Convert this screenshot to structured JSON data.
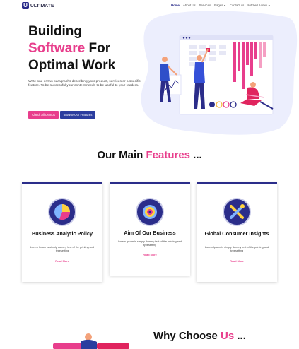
{
  "brand": {
    "logo_letter": "U",
    "name": "ULTIMATE"
  },
  "nav": {
    "items": [
      {
        "label": "Home",
        "active": true,
        "dropdown": false
      },
      {
        "label": "About Us",
        "active": false,
        "dropdown": false
      },
      {
        "label": "Services",
        "active": false,
        "dropdown": false
      },
      {
        "label": "Pages",
        "active": false,
        "dropdown": true
      },
      {
        "label": "Contact us",
        "active": false,
        "dropdown": false
      },
      {
        "label": "Mitchell Admin",
        "active": false,
        "dropdown": true
      }
    ]
  },
  "hero": {
    "title_line1": "Building",
    "title_highlight": "Software",
    "title_after_highlight": " For",
    "title_line3": "Optimal Work",
    "description": "Write one or two paragraphs describing your product, services or a specific feature.  To be successful your content needs to be useful to your readers.",
    "btn_primary": "Check All Demos",
    "btn_secondary": "Browse Our Features"
  },
  "features": {
    "title_before": "Our Main ",
    "title_highlight": "Features",
    "title_after": " ...",
    "cards": [
      {
        "title": "Business Analytic Policy",
        "text": "Lorem Ipsum is simply dummy text of the printing and typesetting",
        "link": "Read More",
        "icon": "pie-chart-icon"
      },
      {
        "title": "Aim Of Our Business",
        "text": "Lorem Ipsum is simply dummy text of the printing and typesetting",
        "link": "Read More",
        "icon": "gear-target-icon"
      },
      {
        "title": "Global Consumer Insights",
        "text": "Lorem Ipsum is simply dummy text of the printing and typesetting",
        "link": "Read More",
        "icon": "tools-icon"
      }
    ]
  },
  "why": {
    "title_before": "Why Choose ",
    "title_highlight": "Us",
    "title_after": " ..."
  },
  "colors": {
    "accent": "#e83e8c",
    "brand": "#2b2d8a",
    "blob": "#eceefd"
  }
}
